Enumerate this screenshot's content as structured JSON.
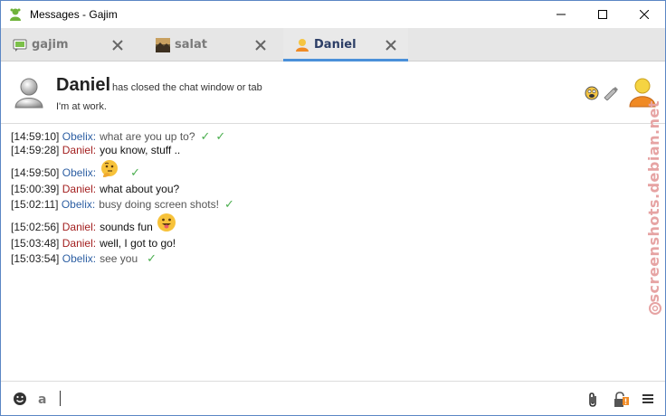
{
  "window": {
    "title": "Messages - Gajim"
  },
  "tabs": [
    {
      "label": "gajim",
      "icon": "chat-bubble-icon",
      "active": false
    },
    {
      "label": "salat",
      "icon": "landscape-avatar-icon",
      "active": false
    },
    {
      "label": "Daniel",
      "icon": "user-orange-icon",
      "active": true
    }
  ],
  "header": {
    "name": "Daniel",
    "status_message": "has closed the chat window or tab",
    "activity": "I'm at work."
  },
  "messages": [
    {
      "time": "[14:59:10]",
      "nick": "Obelix:",
      "text": "what are you up to?",
      "direction": "out",
      "checks": 2
    },
    {
      "time": "[14:59:28]",
      "nick": "Daniel:",
      "text": "you know, stuff ..",
      "direction": "in",
      "checks": 0
    },
    {
      "time": "[14:59:50]",
      "nick": "Obelix:",
      "text": "",
      "direction": "out",
      "emoji": "thinking-face-icon",
      "checks": 1
    },
    {
      "time": "[15:00:39]",
      "nick": "Daniel:",
      "text": "what about you?",
      "direction": "in",
      "checks": 0
    },
    {
      "time": "[15:02:11]",
      "nick": "Obelix:",
      "text": "busy doing screen shots!",
      "direction": "out",
      "checks": 1
    },
    {
      "time": "[15:02:56]",
      "nick": "Daniel:",
      "text": "sounds fun",
      "direction": "in",
      "emoji": "tongue-face-icon",
      "checks": 0
    },
    {
      "time": "[15:03:48]",
      "nick": "Daniel:",
      "text": "well, I got to go!",
      "direction": "in",
      "checks": 0
    },
    {
      "time": "[15:03:54]",
      "nick": "Obelix:",
      "text": "see you",
      "direction": "out",
      "checks": 1
    }
  ],
  "checkmark": "✓",
  "watermark": {
    "text": "screenshots.debian.net"
  },
  "colors": {
    "accent": "#4a90d9",
    "outgoing_nick": "#2d5fa3",
    "incoming_nick": "#a32020",
    "check": "#4caf50"
  }
}
